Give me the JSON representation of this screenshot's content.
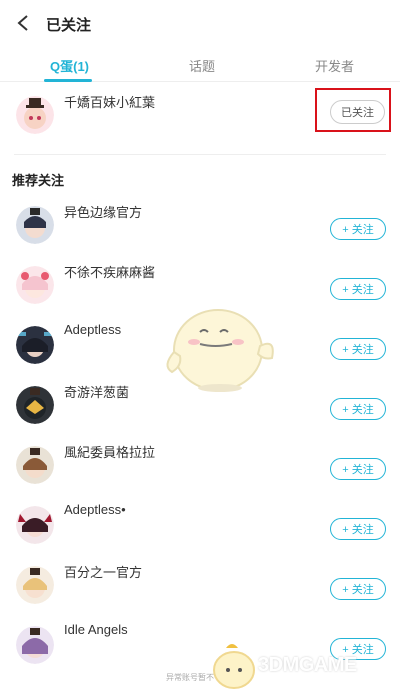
{
  "header": {
    "title": "已关注"
  },
  "tabs": [
    {
      "label": "Q蛋(1)"
    },
    {
      "label": "话题"
    },
    {
      "label": "开发者"
    }
  ],
  "followed": {
    "name": "千嬌百妹小紅葉",
    "button": "已关注"
  },
  "recommend": {
    "title": "推荐关注",
    "button": "+ 关注",
    "items": [
      {
        "name": "异色边缘官方"
      },
      {
        "name": "不徐不疾麻麻酱"
      },
      {
        "name": "Adeptless"
      },
      {
        "name": "奇游洋葱菌"
      },
      {
        "name": "風紀委員格拉拉"
      },
      {
        "name": "Adeptless•"
      },
      {
        "name": "百分之一官方"
      },
      {
        "name": "Idle Angels"
      }
    ]
  },
  "footer": {
    "note": "异常账号暂不"
  },
  "watermark": {
    "text": "3DMGAME"
  },
  "colors": {
    "accent": "#22b4d6",
    "highlight": "#d9121a"
  }
}
